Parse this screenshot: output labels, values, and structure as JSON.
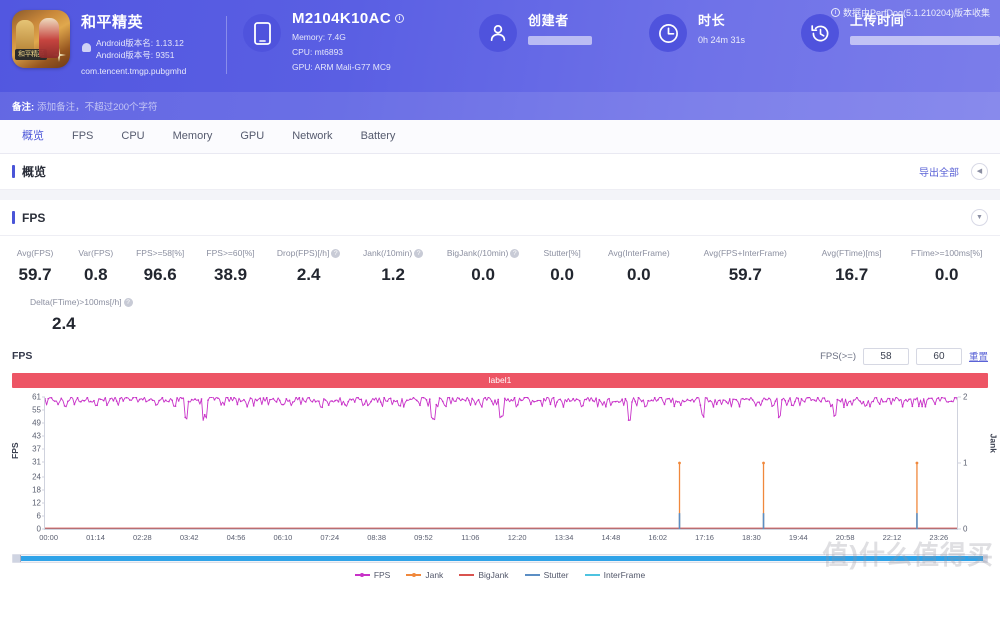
{
  "header": {
    "app": {
      "name": "和平精英",
      "version_name_line": "Android版本名: 1.13.12",
      "version_code_line": "Android版本号: 9351",
      "package": "com.tencent.tmgp.pubgmhd",
      "icon": "game-app-icon"
    },
    "device": {
      "name": "M2104K10AC",
      "memory": "Memory: 7.4G",
      "cpu": "CPU: mt6893",
      "gpu": "GPU: ARM Mali-G77 MC9",
      "icon": "phone-icon",
      "info_icon": "info-icon"
    },
    "creator": {
      "title": "创建者",
      "value": "",
      "icon": "user-icon"
    },
    "duration": {
      "title": "时长",
      "value": "0h 24m 31s",
      "icon": "clock-icon"
    },
    "upload_time": {
      "title": "上传时间",
      "value": "",
      "icon": "history-icon"
    },
    "perfdog_note": "数据由PerfDog(5.1.210204)版本收集",
    "perfdog_icon": "info-icon",
    "memo_label": "备注:",
    "memo_placeholder": "添加备注，不超过200个字符"
  },
  "tabs": [
    {
      "label": "概览",
      "active": true
    },
    {
      "label": "FPS",
      "active": false
    },
    {
      "label": "CPU",
      "active": false
    },
    {
      "label": "Memory",
      "active": false
    },
    {
      "label": "GPU",
      "active": false
    },
    {
      "label": "Network",
      "active": false
    },
    {
      "label": "Battery",
      "active": false
    }
  ],
  "overview": {
    "title": "概览",
    "export_all": "导出全部",
    "collapse_icon": "chevron-left-icon"
  },
  "fps_section": {
    "title": "FPS",
    "expand_icon": "chevron-down-icon",
    "metrics_row1": [
      {
        "label": "Avg(FPS)",
        "value": "59.7",
        "help": false
      },
      {
        "label": "Var(FPS)",
        "value": "0.8",
        "help": false
      },
      {
        "label": "FPS>=58[%]",
        "value": "96.6",
        "help": false
      },
      {
        "label": "FPS>=60[%]",
        "value": "38.9",
        "help": false
      },
      {
        "label": "Drop(FPS)[/h]",
        "value": "2.4",
        "help": true
      },
      {
        "label": "Jank(/10min)",
        "value": "1.2",
        "help": true
      },
      {
        "label": "BigJank(/10min)",
        "value": "0.0",
        "help": true
      },
      {
        "label": "Stutter[%]",
        "value": "0.0",
        "help": false
      },
      {
        "label": "Avg(InterFrame)",
        "value": "0.0",
        "help": false
      },
      {
        "label": "Avg(FPS+InterFrame)",
        "value": "59.7",
        "help": false
      },
      {
        "label": "Avg(FTime)[ms]",
        "value": "16.7",
        "help": false
      },
      {
        "label": "FTime>=100ms[%]",
        "value": "0.0",
        "help": false
      }
    ],
    "metrics_row2": [
      {
        "label": "Delta(FTime)>100ms[/h]",
        "value": "2.4",
        "help": true
      }
    ]
  },
  "chart_panel": {
    "chart_label": "FPS",
    "fps_filter_label": "FPS(>=)",
    "fps_min": "58",
    "fps_max": "60",
    "reset_label": "重置",
    "segment_label": "label1",
    "segment_color": "#ed5565"
  },
  "watermark": "值)什么值得买",
  "chart_data": {
    "type": "line",
    "title": "FPS",
    "xlabel": "",
    "ylabel": "FPS",
    "y2label": "Jank",
    "ylim": [
      0,
      61
    ],
    "y2lim": [
      0,
      2
    ],
    "yticks": [
      0,
      6,
      12,
      18,
      24,
      31,
      37,
      43,
      49,
      55,
      61
    ],
    "y2ticks": [
      0,
      1,
      2
    ],
    "xticks": [
      "00:00",
      "01:14",
      "02:28",
      "03:42",
      "04:56",
      "06:10",
      "07:24",
      "08:38",
      "09:52",
      "11:06",
      "12:20",
      "13:34",
      "14:48",
      "16:02",
      "17:16",
      "18:30",
      "19:44",
      "20:58",
      "22:12",
      "23:26"
    ],
    "grid": false,
    "legend_position": "bottom",
    "series": [
      {
        "name": "FPS",
        "color": "#c832c8",
        "axis": "left",
        "marker": true,
        "description": "Dense noisy band oscillating between 56 and 61 FPS for the whole 24 minute session, with occasional dips to ~50 near 03:42, ~17:30 and ~22:50",
        "approx_mean": 59.7,
        "approx_min": 50,
        "approx_max": 61
      },
      {
        "name": "Jank",
        "color": "#f0883c",
        "axis": "right",
        "marker": true,
        "description": "Flat at 0 with three isolated spikes reaching 1",
        "spikes": [
          {
            "x": "16:50",
            "y": 1
          },
          {
            "x": "19:05",
            "y": 1
          },
          {
            "x": "23:05",
            "y": 1
          }
        ]
      },
      {
        "name": "BigJank",
        "color": "#d9534f",
        "axis": "right",
        "marker": false,
        "description": "Flat at 0 across the full session",
        "values_constant": 0
      },
      {
        "name": "Stutter",
        "color": "#5b8ec4",
        "axis": "right",
        "marker": false,
        "description": "Flat at 0 with three small bumps co-located with Jank spikes",
        "spikes": [
          {
            "x": "16:50",
            "y": 0.2
          },
          {
            "x": "19:05",
            "y": 0.2
          },
          {
            "x": "23:05",
            "y": 0.2
          }
        ]
      },
      {
        "name": "InterFrame",
        "color": "#4ec3e0",
        "axis": "right",
        "marker": false,
        "description": "Flat at 0 across the full session",
        "values_constant": 0
      }
    ],
    "legend": [
      {
        "label": "FPS",
        "color": "#c832c8",
        "marker": true
      },
      {
        "label": "Jank",
        "color": "#f0883c",
        "marker": true
      },
      {
        "label": "BigJank",
        "color": "#d9534f",
        "marker": false
      },
      {
        "label": "Stutter",
        "color": "#5b8ec4",
        "marker": false
      },
      {
        "label": "InterFrame",
        "color": "#4ec3e0",
        "marker": false
      }
    ]
  }
}
